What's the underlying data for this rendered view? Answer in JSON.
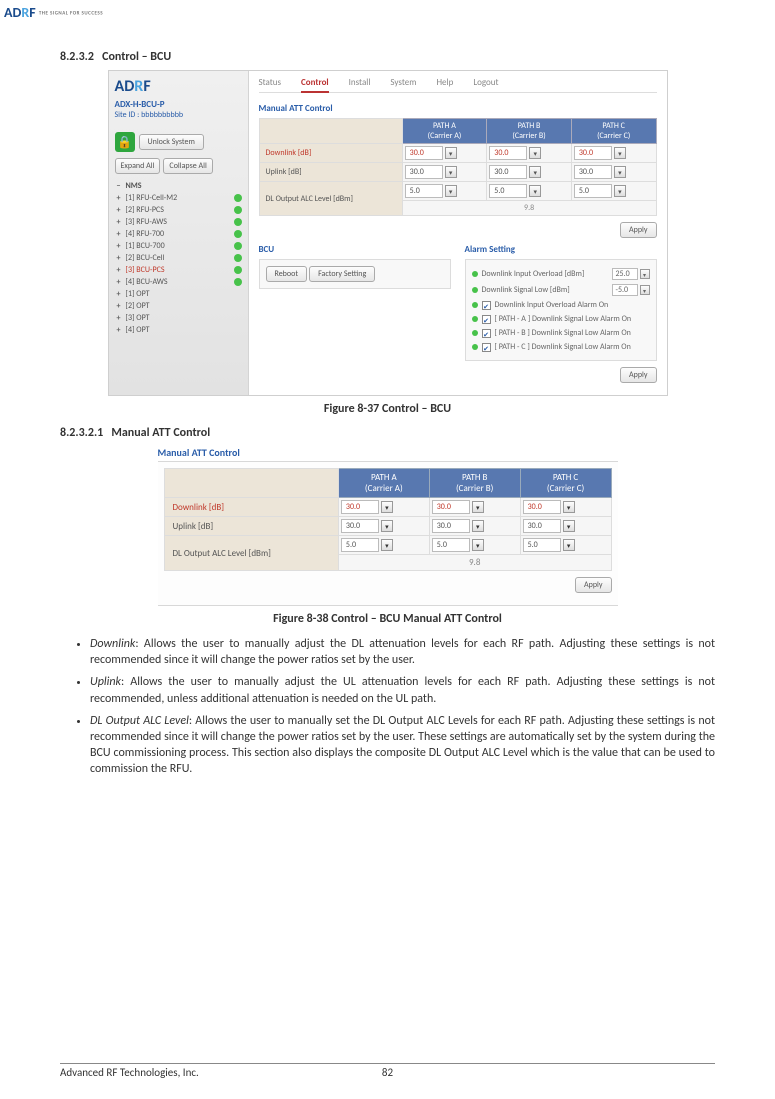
{
  "logo": {
    "brand": "ADRF",
    "tagline": "THE SIGNAL FOR SUCCESS"
  },
  "section": {
    "num": "8.2.3.2",
    "title": "Control – BCU"
  },
  "fig1": {
    "caption": "Figure 8-37    Control – BCU"
  },
  "subsection": {
    "num": "8.2.3.2.1",
    "title": "Manual ATT Control"
  },
  "fig2": {
    "caption": "Figure 8-38    Control – BCU Manual ATT Control"
  },
  "footer": {
    "company": "Advanced RF Technologies, Inc.",
    "page": "82"
  },
  "ui1": {
    "model": "ADX-H-BCU-P",
    "siteid": "Site ID : bbbbbbbbbb",
    "unlock": "Unlock System",
    "expand": "Expand All",
    "collapse": "Collapse All",
    "tree_root": "NMS",
    "tree": [
      {
        "p": "+",
        "label": "[1] RFU-Cell-M2",
        "dot": true,
        "sel": false
      },
      {
        "p": "+",
        "label": "[2] RFU-PCS",
        "dot": true,
        "sel": false
      },
      {
        "p": "+",
        "label": "[3] RFU-AWS",
        "dot": true,
        "sel": false
      },
      {
        "p": "+",
        "label": "[4] RFU-700",
        "dot": true,
        "sel": false
      },
      {
        "p": "+",
        "label": "[1] BCU-700",
        "dot": true,
        "sel": false
      },
      {
        "p": "+",
        "label": "[2] BCU-Cell",
        "dot": true,
        "sel": false
      },
      {
        "p": "+",
        "label": "[3] BCU-PCS",
        "dot": true,
        "sel": true
      },
      {
        "p": "+",
        "label": "[4] BCU-AWS",
        "dot": true,
        "sel": false
      },
      {
        "p": "+",
        "label": "[1] OPT",
        "dot": false,
        "sel": false
      },
      {
        "p": "+",
        "label": "[2] OPT",
        "dot": false,
        "sel": false
      },
      {
        "p": "+",
        "label": "[3] OPT",
        "dot": false,
        "sel": false
      },
      {
        "p": "+",
        "label": "[4] OPT",
        "dot": false,
        "sel": false
      }
    ],
    "tabs": [
      "Status",
      "Control",
      "Install",
      "System",
      "Help",
      "Logout"
    ],
    "active_tab": 1,
    "matt_title": "Manual ATT Control",
    "paths": [
      {
        "path": "PATH A",
        "carrier": "(Carrier A)"
      },
      {
        "path": "PATH B",
        "carrier": "(Carrier B)"
      },
      {
        "path": "PATH C",
        "carrier": "(Carrier C)"
      }
    ],
    "rows": [
      {
        "label": "Downlink [dB]",
        "sel": true,
        "vals": [
          "30.0",
          "30.0",
          "30.0"
        ],
        "orange": true
      },
      {
        "label": "Uplink [dB]",
        "sel": false,
        "vals": [
          "30.0",
          "30.0",
          "30.0"
        ],
        "orange": false
      },
      {
        "label": "DL Output ALC Level [dBm]",
        "sel": false,
        "vals": [
          "5.0",
          "5.0",
          "5.0"
        ],
        "orange": false
      }
    ],
    "composite": "9.8",
    "apply": "Apply",
    "bcu_title": "BCU",
    "reboot": "Reboot",
    "factory": "Factory Setting",
    "alarm_title": "Alarm Setting",
    "alarms_val": [
      {
        "label": "Downlink Input Overload [dBm]",
        "val": "25.0"
      },
      {
        "label": "Downlink Signal Low [dBm]",
        "val": "-5.0"
      }
    ],
    "alarms_chk": [
      "Downlink Input Overload Alarm On",
      "[ PATH - A ] Downlink Signal Low Alarm On",
      "[ PATH - B ] Downlink Signal Low Alarm On",
      "[ PATH - C ] Downlink Signal Low Alarm On"
    ]
  },
  "ui2": {
    "title": "Manual ATT Control",
    "paths": [
      {
        "path": "PATH A",
        "carrier": "(Carrier A)"
      },
      {
        "path": "PATH B",
        "carrier": "(Carrier B)"
      },
      {
        "path": "PATH C",
        "carrier": "(Carrier C)"
      }
    ],
    "rows": [
      {
        "label": "Downlink [dB]",
        "sel": true,
        "vals": [
          "30.0",
          "30.0",
          "30.0"
        ],
        "orange": true
      },
      {
        "label": "Uplink [dB]",
        "sel": false,
        "vals": [
          "30.0",
          "30.0",
          "30.0"
        ],
        "orange": false
      },
      {
        "label": "DL Output ALC Level [dBm]",
        "sel": false,
        "vals": [
          "5.0",
          "5.0",
          "5.0"
        ],
        "orange": false
      }
    ],
    "composite": "9.8",
    "apply": "Apply"
  },
  "bullets": [
    {
      "term": "Downlink",
      "text": ": Allows the user to manually adjust the DL attenuation levels for each RF path.  Adjusting these settings is not recommended since it will change the power ratios set by the user."
    },
    {
      "term": "Uplink",
      "text": ": Allows the user to manually adjust the UL attenuation levels for each RF path.  Adjusting these settings is not recommended, unless additional attenuation is needed on the UL path."
    },
    {
      "term": "DL Output ALC Level",
      "text": ": Allows the user to manually set the DL Output ALC Levels for each RF path.  Adjusting these settings is not recommended since it will change the power ratios set by the user.  These settings are automatically set by the system during the BCU commissioning process.  This section also displays the composite DL Output ALC Level which is the value that can be used to commission the RFU."
    }
  ]
}
